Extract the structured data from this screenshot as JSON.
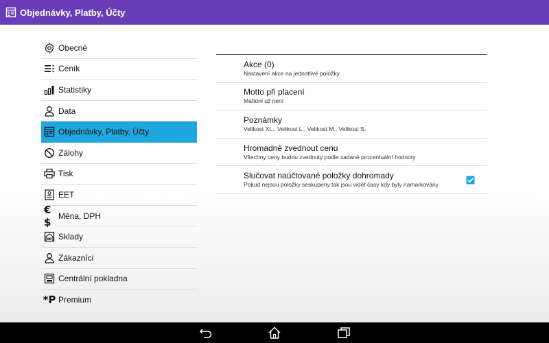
{
  "titlebar": {
    "title": "Objednávky, Platby, Účty",
    "icon": "document-list-icon",
    "color": "#6a3db8"
  },
  "sidebar": {
    "active_color": "#1fa7df",
    "items": [
      {
        "label": "Obecné",
        "icon": "gear-icon"
      },
      {
        "label": "Ceník",
        "icon": "list-icon"
      },
      {
        "label": "Statistiky",
        "icon": "bar-chart-icon"
      },
      {
        "label": "Data",
        "icon": "person-icon"
      },
      {
        "label": "Objednávky, Platby, Účty",
        "icon": "document-list-icon",
        "active": true
      },
      {
        "label": "Zálohy",
        "icon": "no-sign-icon"
      },
      {
        "label": "Tisk",
        "icon": "printer-icon"
      },
      {
        "label": "EET",
        "icon": "receipt-icon"
      },
      {
        "label": "Měna, DPH",
        "icon": "currency-icon",
        "glyph": "€$"
      },
      {
        "label": "Sklady",
        "icon": "warehouse-icon"
      },
      {
        "label": "Zákazníci",
        "icon": "person-icon"
      },
      {
        "label": "Centrální pokladna",
        "icon": "register-icon"
      },
      {
        "label": "Premium",
        "icon": "premium-icon",
        "glyph": "*P"
      }
    ]
  },
  "preferences": [
    {
      "title": "Akce (0)",
      "summary": "Nastavení akce na jednotlivé položky"
    },
    {
      "title": "Motto při placení",
      "summary": "Mattoni už není"
    },
    {
      "title": "Poznámky",
      "summary": "Velikost XL., Velikost L., Velikost M., Velikost S."
    },
    {
      "title": "Hromadně zvednout cenu",
      "summary": "Všechny ceny budou zvednuty podle zadané procentuální hodnoty"
    },
    {
      "title": "Slučovat naúčtované položky dohromady",
      "summary": "Pokud nejsou položky seskupeny tak jsou vidět časy kdy byly namarkovány",
      "checked": true
    }
  ],
  "navbar": {
    "buttons": [
      "back-icon",
      "home-icon",
      "recent-apps-icon"
    ]
  }
}
